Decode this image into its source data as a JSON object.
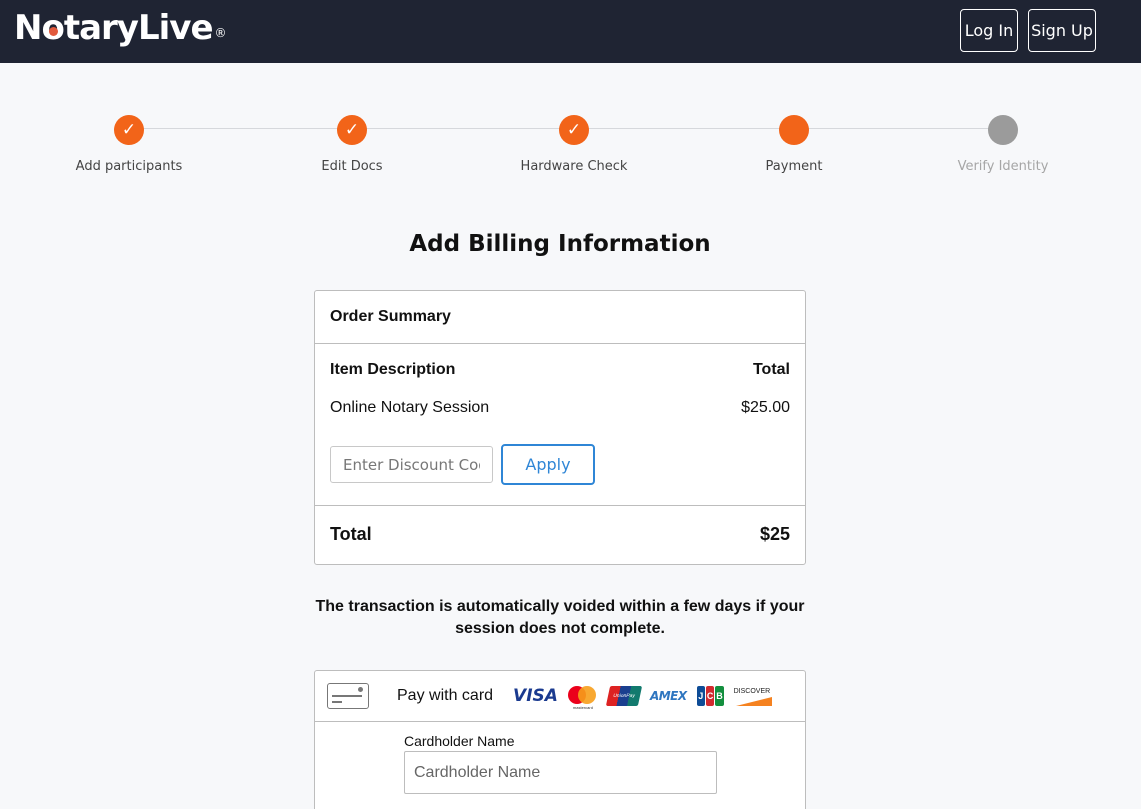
{
  "header": {
    "logo_text": "NotaryLive",
    "logo_registered": "®",
    "login_label": "Log In",
    "signup_label": "Sign Up"
  },
  "stepper": {
    "steps": [
      {
        "label": "Add participants",
        "status": "complete",
        "mark": "✓"
      },
      {
        "label": "Edit Docs",
        "status": "complete",
        "mark": "✓"
      },
      {
        "label": "Hardware Check",
        "status": "complete",
        "mark": "✓"
      },
      {
        "label": "Payment",
        "status": "current",
        "mark": ""
      },
      {
        "label": "Verify Identity",
        "status": "pending",
        "mark": ""
      }
    ],
    "colors": {
      "active": "#f26419",
      "pending": "#9b9b9b"
    }
  },
  "page_title": "Add Billing Information",
  "order_summary": {
    "title": "Order Summary",
    "col_description": "Item Description",
    "col_total": "Total",
    "item_name": "Online Notary Session",
    "item_price": "$25.00",
    "discount_placeholder": "Enter Discount Code",
    "apply_label": "Apply",
    "total_label": "Total",
    "total_value": "$25"
  },
  "notice": "The transaction is automatically voided within a few days if your session does not complete.",
  "payment": {
    "pay_label": "Pay with card",
    "brands": {
      "visa": "VISA",
      "mastercard": "mastercard",
      "unionpay": "UnionPay",
      "amex": "AMEX",
      "jcb": [
        "J",
        "C",
        "B"
      ],
      "discover": "DISCOVER"
    },
    "cardholder_label": "Cardholder Name",
    "cardholder_placeholder": "Cardholder Name"
  }
}
